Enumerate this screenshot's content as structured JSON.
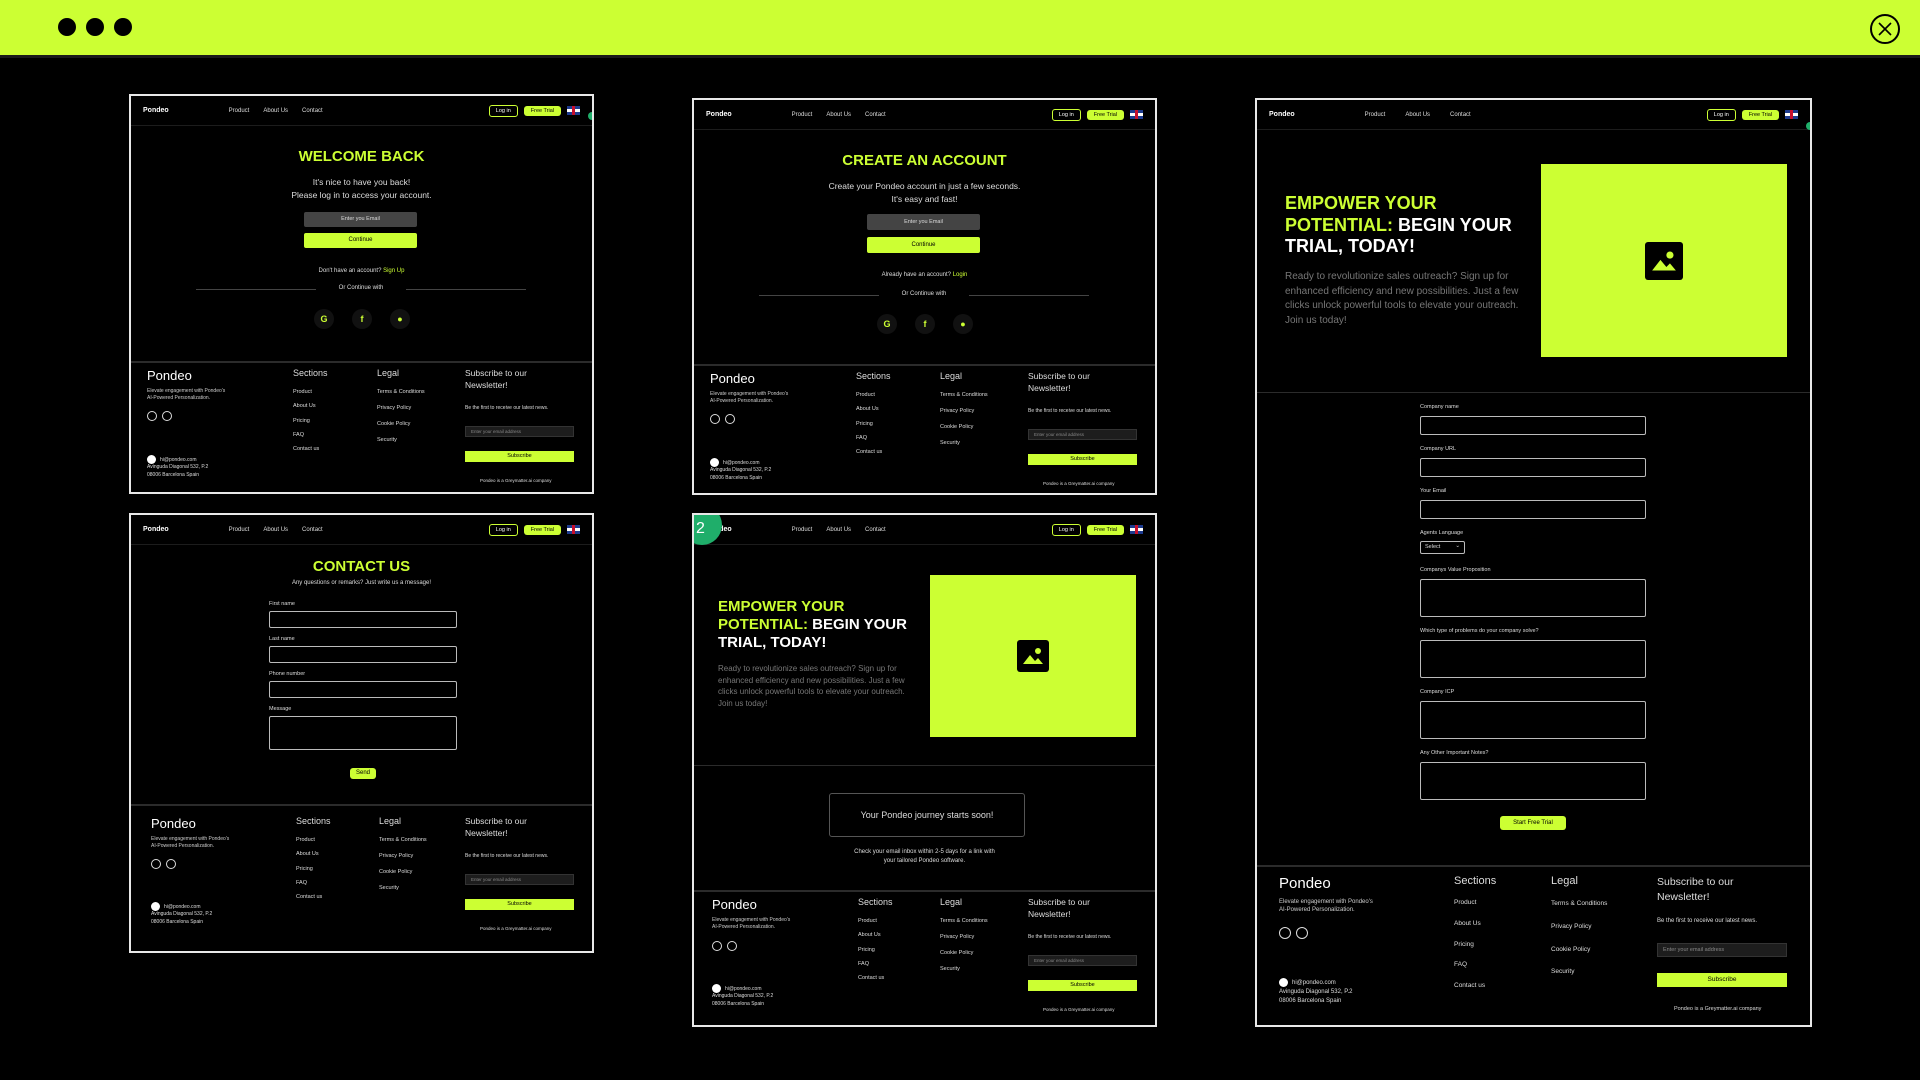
{
  "nav": {
    "logo": "Pondeo",
    "product": "Product",
    "about": "About Us",
    "contact": "Contact",
    "login": "Log in",
    "trial": "Free Trial"
  },
  "login": {
    "title": "WELCOME BACK",
    "sub1": "It's nice to have you back!",
    "sub2": "Please log in to access your account.",
    "email_placeholder": "Enter you Email",
    "continue": "Continue",
    "no_account": "Don't have an account?",
    "signup": "Sign Up",
    "or": "Or Continue with"
  },
  "signup": {
    "title": "CREATE AN ACCOUNT",
    "sub1": "Create your Pondeo account in just a few seconds.",
    "sub2": "It's easy and fast!",
    "email_placeholder": "Enter you Email",
    "continue": "Continue",
    "have_account": "Already have an account?",
    "login": "Login",
    "or": "Or Continue with"
  },
  "social": {
    "google": "G",
    "facebook": "f",
    "apple": ""
  },
  "contact": {
    "title": "CONTACT US",
    "sub": "Any questions or remarks? Just write us a message!",
    "first": "First name",
    "last": "Last name",
    "phone": "Phone number",
    "message": "Message",
    "send": "Send"
  },
  "hero": {
    "title_a": "EMPOWER YOUR POTENTIAL:",
    "title_b": " BEGIN YOUR TRIAL, TODAY!",
    "text": "Ready to revolutionize sales outreach? Sign up for enhanced efficiency and new possibilities. Just a few clicks unlock powerful tools to elevate your outreach. Join us today!"
  },
  "trial_done": {
    "step": "2",
    "box": "Your Pondeo journey starts soon!",
    "note1": "Check your email inbox within 2-5 days for a link with",
    "note2": "your tailored Pondeo software."
  },
  "trial_form": {
    "company_name": "Company name",
    "company_url": "Company URL",
    "your_email": "Your Email",
    "agents_language": "Agents Language",
    "select": "Select",
    "value_prop": "Companys Value Proposition",
    "problems": "Which type of problems do your company solve?",
    "icp": "Company ICP",
    "notes": "Any Other Important Notes?",
    "start": "Start Free Trial"
  },
  "footer": {
    "brand": "Pondeo",
    "tag1": "Elevate engagement with Pondeo's",
    "tag2": "AI-Powered Personalization.",
    "sections": "Sections",
    "legal": "Legal",
    "items": [
      "Product",
      "About Us",
      "Pricing",
      "FAQ",
      "Contact us"
    ],
    "legal_items": [
      "Terms & Conditions",
      "Privacy Policy",
      "Cookie Policy",
      "Security"
    ],
    "news1": "Subscribe to our",
    "news2": "Newsletter!",
    "news_sub": "Be the first to receive our latest news.",
    "email_placeholder": "Enter your email address",
    "subscribe": "Subscribe",
    "gm": "Pondeo is a Greymatter.ai company",
    "email": "hi@pondeo.com",
    "addr1": "Avinguda Diagonal 532, P.2",
    "addr2": "08006 Barcelona Spain"
  },
  "colors": {
    "accent": "#CCFF33",
    "bg": "#000000"
  }
}
